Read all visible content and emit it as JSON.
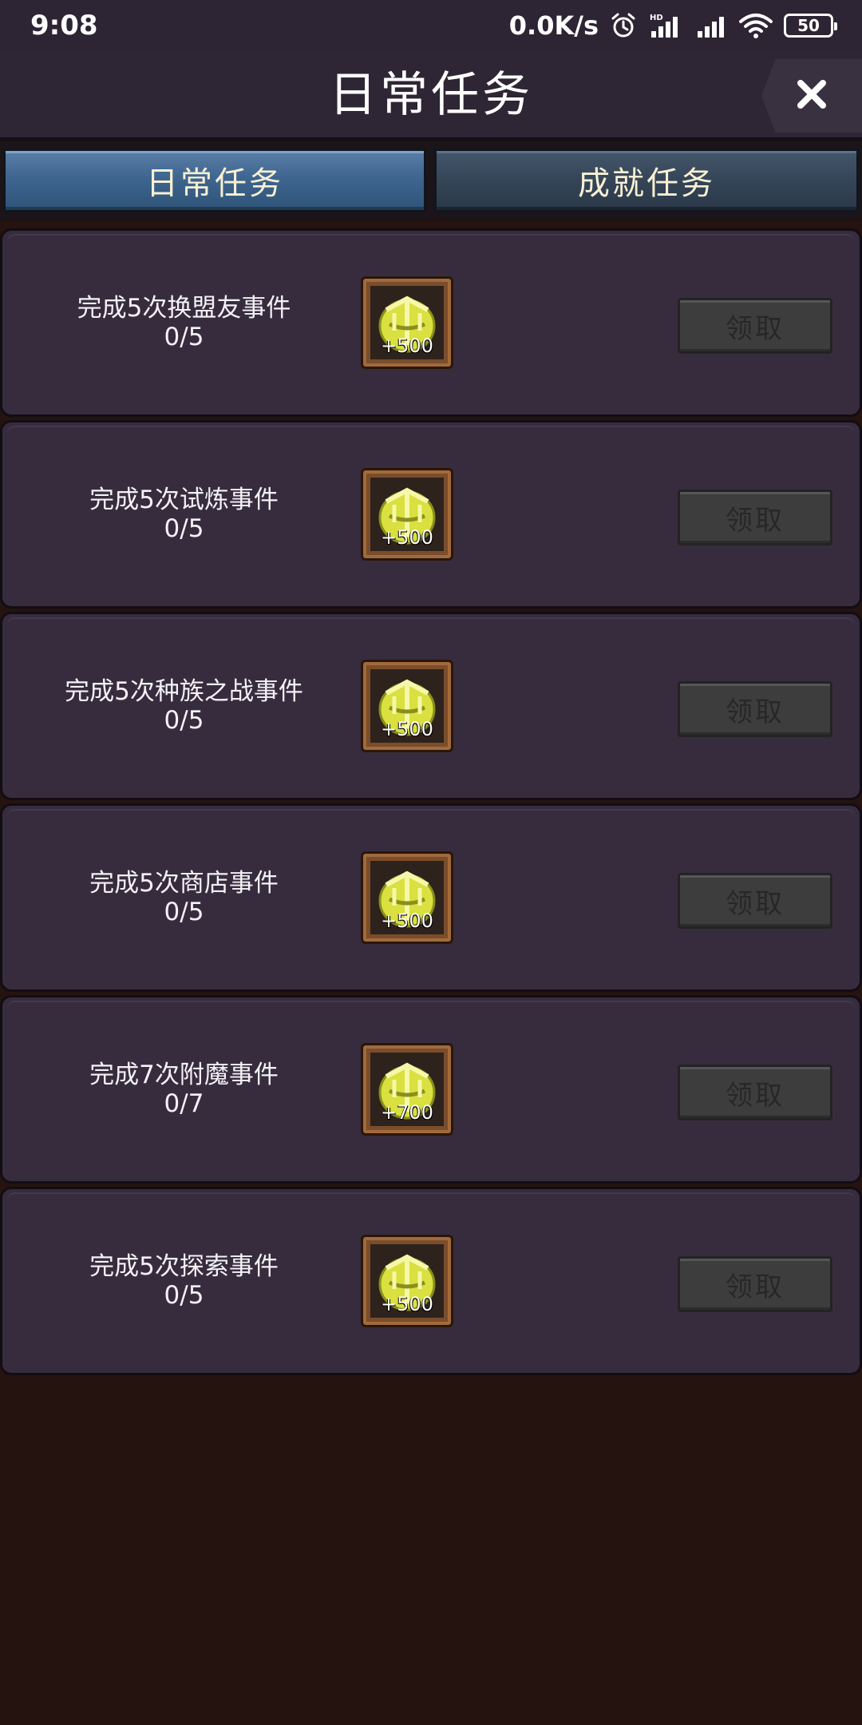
{
  "status_bar": {
    "time": "9:08",
    "net_speed": "0.0K/s",
    "battery": "50"
  },
  "header": {
    "title": "日常任务"
  },
  "tabs": [
    {
      "label": "日常任务",
      "active": true
    },
    {
      "label": "成就任务",
      "active": false
    }
  ],
  "tasks": [
    {
      "name": "完成5次换盟友事件",
      "progress": "0/5",
      "reward": "+500",
      "button": "领取"
    },
    {
      "name": "完成5次试炼事件",
      "progress": "0/5",
      "reward": "+500",
      "button": "领取"
    },
    {
      "name": "完成5次种族之战事件",
      "progress": "0/5",
      "reward": "+500",
      "button": "领取"
    },
    {
      "name": "完成5次商店事件",
      "progress": "0/5",
      "reward": "+500",
      "button": "领取"
    },
    {
      "name": "完成7次附魔事件",
      "progress": "0/7",
      "reward": "+700",
      "button": "领取"
    },
    {
      "name": "完成5次探索事件",
      "progress": "0/5",
      "reward": "+500",
      "button": "领取"
    }
  ],
  "icons": {
    "reward_icon": "gold-emblem-icon",
    "close_icon": "close-icon"
  },
  "colors": {
    "active_tab": "#3f6690",
    "inactive_tab": "#354558",
    "card_bg": "#372c3e",
    "page_bg": "#24130e",
    "reward_gold": "#d9e040"
  }
}
